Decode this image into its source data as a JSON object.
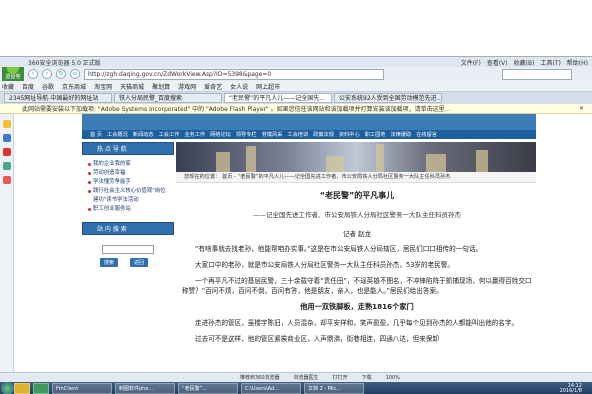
{
  "browser": {
    "title": "360安全浏览器 5.0 正式版",
    "logo_label": "遗留卷",
    "menu": [
      "文件(F)",
      "查看(V)",
      "收藏(B)",
      "工具(T)",
      "帮助(H)"
    ],
    "url": "http://zgh.daqing.gov.cn/ZdWorkView.Asp?ID=5398&page=0",
    "favorites": [
      "收藏",
      "百度",
      "谷歌",
      "京东商城",
      "淘宝网",
      "天猫商城",
      "聚划算",
      "游戏网",
      "爱奇艺",
      "女人说",
      "网上超市"
    ],
    "tabs": [
      "2345网址导航-中国最好的网址站",
      "铁人分局民警_百度搜索",
      "“老民警”的平凡人儿——记全国先...",
      "公安系统92人受到全国劳动模范先进..."
    ],
    "notice": "此网站需要安装以下加载项: \"Adobe Systems Incorporated\" 中的 \"Adobe Flash Player\" 。如果您信任该网站和该加载项并打算安装该加载项，请单击这里...",
    "notice_close": "✕"
  },
  "site": {
    "main_nav": [
      "首 页",
      "工会概况",
      "新闻动态",
      "工会工作",
      "业务工作",
      "网络论坛",
      "领导专栏",
      "劳模风采",
      "工会培训",
      "政策法规",
      "资料中心",
      "职工园地",
      "法律援助",
      "在线留言"
    ],
    "sidebar_title": "热 点 导 航",
    "sidebar_items": [
      "我的企业我的家",
      "劳动创造幸福",
      "学法懂劳争能手",
      "践行社会主义核心价值观\"岗位建功\"读书学法活动",
      "职工创业服务站"
    ],
    "search_title": "站 内 搜 索",
    "search_btn": "搜索",
    "reset_btn": "返回",
    "breadcrumb": "您现在的位置： 首页 - “老民警”的平凡人儿——记全国先进工作者、市公安局铁人分局社区警务一大队主任科员孙杰"
  },
  "article": {
    "title": "“老民警”的平凡事儿",
    "subtitle": "——记全国先进工作者、市公安局铁人分局社区警务一大队主任科员孙杰",
    "author": "记者  赵龙",
    "paragraphs": [
      "“有啥事就去找老孙，他能帮咱办实事。”这是在市公安局铁人分局辖区，居民们口口相传的一句话。",
      "大家口中的老孙，就是市公安局铁人分局社区警务一大队主任科员孙杰，53岁的老民警。",
      "一个再平凡不过的基层民警，三十余载守着“责任田”，不逞英雄不图名，不冲锋陷阵于抓捕现场，何以赢得百姓交口称赞？“百问不烦，百问不倒，百问有答，他是朋友，亲人，也是能人。”居民们给出答案。"
    ],
    "heading": "他用一双铁脚板，走熟1816个家门",
    "paragraphs2": [
      "走进孙杰的管区，虽楼宇陈旧，人员混杂，却平安祥和，笑声盈盈，几乎每个见到孙杰的人都能叫出他的名字。",
      "过去可不是这样，他的管区紧挨商业区，人声鼎沸，街巷相连，四通八达，但来保卸"
    ]
  },
  "status": {
    "items": [
      "推荐到360浏览器",
      "浏览器医生",
      "打打开",
      "下载",
      "100%"
    ]
  },
  "taskbar": {
    "tasks": [
      "FmClient",
      "制图软件pho...",
      "“老民警”...",
      "C:\\Users\\Ad...",
      "文档 2 - Mic..."
    ],
    "time": "14:12",
    "date": "2016/1/8"
  }
}
